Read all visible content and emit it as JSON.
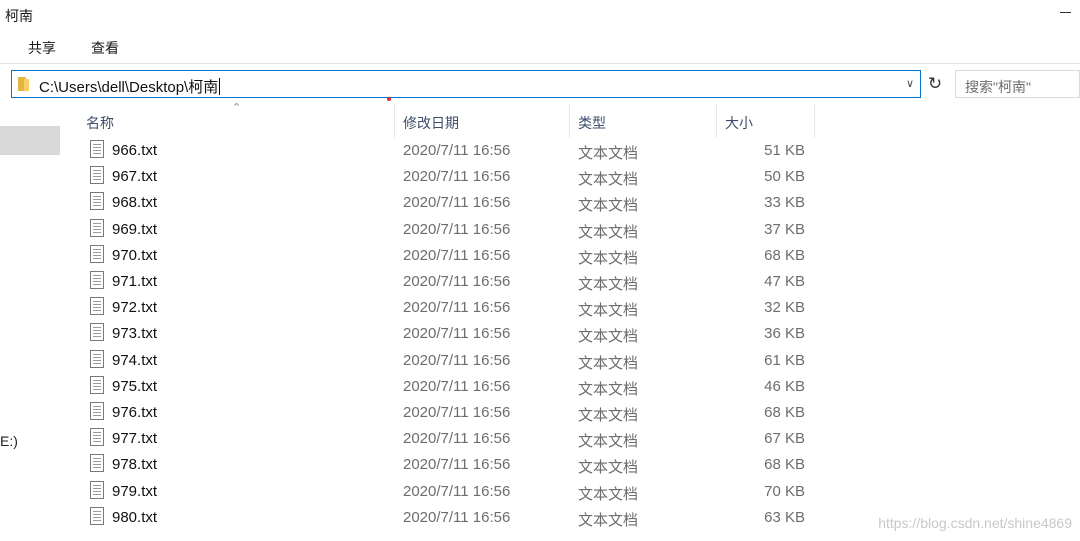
{
  "window": {
    "title": "柯南"
  },
  "ribbon": {
    "tabs": [
      "共享",
      "查看"
    ]
  },
  "address": {
    "path": "C:\\Users\\dell\\Desktop\\柯南"
  },
  "search": {
    "placeholder": "搜索\"柯南\""
  },
  "nav": {
    "drive_label": "E:)"
  },
  "columns": {
    "name": "名称",
    "date": "修改日期",
    "type": "类型",
    "size": "大小"
  },
  "files": [
    {
      "name": "966.txt",
      "date": "2020/7/11 16:56",
      "type": "文本文档",
      "size": "51 KB"
    },
    {
      "name": "967.txt",
      "date": "2020/7/11 16:56",
      "type": "文本文档",
      "size": "50 KB"
    },
    {
      "name": "968.txt",
      "date": "2020/7/11 16:56",
      "type": "文本文档",
      "size": "33 KB"
    },
    {
      "name": "969.txt",
      "date": "2020/7/11 16:56",
      "type": "文本文档",
      "size": "37 KB"
    },
    {
      "name": "970.txt",
      "date": "2020/7/11 16:56",
      "type": "文本文档",
      "size": "68 KB"
    },
    {
      "name": "971.txt",
      "date": "2020/7/11 16:56",
      "type": "文本文档",
      "size": "47 KB"
    },
    {
      "name": "972.txt",
      "date": "2020/7/11 16:56",
      "type": "文本文档",
      "size": "32 KB"
    },
    {
      "name": "973.txt",
      "date": "2020/7/11 16:56",
      "type": "文本文档",
      "size": "36 KB"
    },
    {
      "name": "974.txt",
      "date": "2020/7/11 16:56",
      "type": "文本文档",
      "size": "61 KB"
    },
    {
      "name": "975.txt",
      "date": "2020/7/11 16:56",
      "type": "文本文档",
      "size": "46 KB"
    },
    {
      "name": "976.txt",
      "date": "2020/7/11 16:56",
      "type": "文本文档",
      "size": "68 KB"
    },
    {
      "name": "977.txt",
      "date": "2020/7/11 16:56",
      "type": "文本文档",
      "size": "67 KB"
    },
    {
      "name": "978.txt",
      "date": "2020/7/11 16:56",
      "type": "文本文档",
      "size": "68 KB"
    },
    {
      "name": "979.txt",
      "date": "2020/7/11 16:56",
      "type": "文本文档",
      "size": "70 KB"
    },
    {
      "name": "980.txt",
      "date": "2020/7/11 16:56",
      "type": "文本文档",
      "size": "63 KB"
    }
  ],
  "watermark": "https://blog.csdn.net/shine4869",
  "icons": {
    "folder": "folder-icon",
    "file": "text-file-icon",
    "refresh": "refresh-icon",
    "dropdown": "chevron-down-icon",
    "sort": "sort-up-icon",
    "minimize": "minimize-icon"
  },
  "colors": {
    "address_border": "#0078d7",
    "selection": "#d9d9d9",
    "header_text": "#3c4e6a",
    "folder": "#e6b53f"
  }
}
